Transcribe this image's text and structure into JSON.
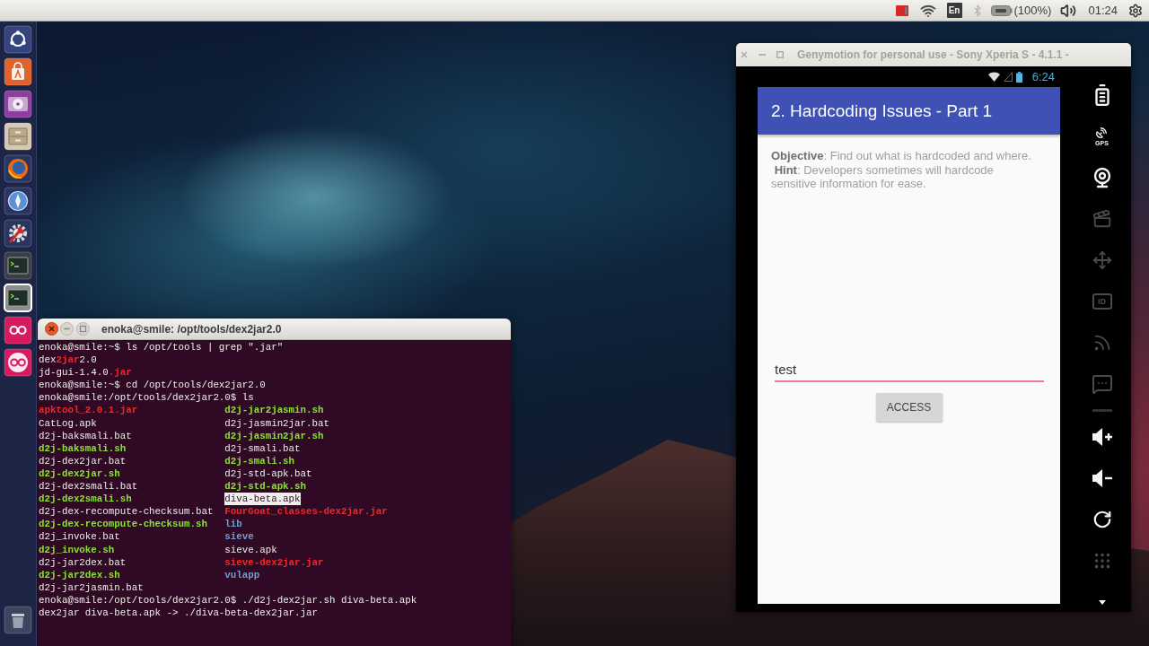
{
  "top_panel": {
    "keyboard_layout": "En",
    "battery": "(100%)",
    "clock": "01:24"
  },
  "launcher": {
    "items": [
      {
        "kind": "dash",
        "focused": false
      },
      {
        "kind": "software",
        "focused": false
      },
      {
        "kind": "media",
        "focused": false
      },
      {
        "kind": "files",
        "focused": false
      },
      {
        "kind": "browser",
        "focused": false
      },
      {
        "kind": "web",
        "focused": false
      },
      {
        "kind": "settings",
        "focused": false
      },
      {
        "kind": "terminal",
        "focused": false
      },
      {
        "kind": "terminal",
        "focused": true
      },
      {
        "kind": "rings",
        "focused": false
      },
      {
        "kind": "ringdisc",
        "focused": false
      }
    ]
  },
  "terminal": {
    "title": "enoka@smile: /opt/tools/dex2jar2.0",
    "head": [
      [
        {
          "text": "enoka@smile:~$ ls /opt/tools | grep \".jar\"",
          "kind": "plain"
        }
      ],
      [
        {
          "text": "dex",
          "kind": "plain"
        },
        {
          "text": "2jar",
          "kind": "match"
        },
        {
          "text": "2.0",
          "kind": "plain"
        }
      ],
      [
        {
          "text": "jd-gui-1.4.0",
          "kind": "plain"
        },
        {
          "text": ".jar",
          "kind": "match"
        }
      ],
      [
        {
          "text": "enoka@smile:~$ cd /opt/tools/dex2jar2.0",
          "kind": "plain"
        }
      ],
      [
        {
          "text": "enoka@smile:/opt/tools/dex2jar2.0$ ls",
          "kind": "plain"
        }
      ]
    ],
    "listing": [
      {
        "cells": [
          {
            "name": "apktool_2.0.1.jar",
            "kind": "archive",
            "selected": false
          },
          {
            "name": "d2j-jar2jasmin.sh",
            "kind": "script",
            "selected": false
          }
        ]
      },
      {
        "cells": [
          {
            "name": "CatLog.apk",
            "kind": "file",
            "selected": false
          },
          {
            "name": "d2j-jasmin2jar.bat",
            "kind": "file",
            "selected": false
          }
        ]
      },
      {
        "cells": [
          {
            "name": "d2j-baksmali.bat",
            "kind": "file",
            "selected": false
          },
          {
            "name": "d2j-jasmin2jar.sh",
            "kind": "script",
            "selected": false
          }
        ]
      },
      {
        "cells": [
          {
            "name": "d2j-baksmali.sh",
            "kind": "script",
            "selected": false
          },
          {
            "name": "d2j-smali.bat",
            "kind": "file",
            "selected": false
          }
        ]
      },
      {
        "cells": [
          {
            "name": "d2j-dex2jar.bat",
            "kind": "file",
            "selected": false
          },
          {
            "name": "d2j-smali.sh",
            "kind": "script",
            "selected": false
          }
        ]
      },
      {
        "cells": [
          {
            "name": "d2j-dex2jar.sh",
            "kind": "script",
            "selected": false
          },
          {
            "name": "d2j-std-apk.bat",
            "kind": "file",
            "selected": false
          }
        ]
      },
      {
        "cells": [
          {
            "name": "d2j-dex2smali.bat",
            "kind": "file",
            "selected": false
          },
          {
            "name": "d2j-std-apk.sh",
            "kind": "script",
            "selected": false
          }
        ]
      },
      {
        "cells": [
          {
            "name": "d2j-dex2smali.sh",
            "kind": "script",
            "selected": false
          },
          {
            "name": "diva-beta.apk",
            "kind": "file",
            "selected": true
          }
        ]
      },
      {
        "cells": [
          {
            "name": "d2j-dex-recompute-checksum.bat",
            "kind": "file",
            "selected": false
          },
          {
            "name": "FourGoat_classes-dex2jar.jar",
            "kind": "archive",
            "selected": false
          }
        ]
      },
      {
        "cells": [
          {
            "name": "d2j-dex-recompute-checksum.sh",
            "kind": "script",
            "selected": false
          },
          {
            "name": "lib",
            "kind": "folder",
            "selected": false
          }
        ]
      },
      {
        "cells": [
          {
            "name": "d2j_invoke.bat",
            "kind": "file",
            "selected": false
          },
          {
            "name": "sieve",
            "kind": "folder",
            "selected": false
          }
        ]
      },
      {
        "cells": [
          {
            "name": "d2j_invoke.sh",
            "kind": "script",
            "selected": false
          },
          {
            "name": "sieve.apk",
            "kind": "file",
            "selected": false
          }
        ]
      },
      {
        "cells": [
          {
            "name": "d2j-jar2dex.bat",
            "kind": "file",
            "selected": false
          },
          {
            "name": "sieve-dex2jar.jar",
            "kind": "archive",
            "selected": false
          }
        ]
      },
      {
        "cells": [
          {
            "name": "d2j-jar2dex.sh",
            "kind": "script",
            "selected": false
          },
          {
            "name": "vulapp",
            "kind": "folder",
            "selected": false
          }
        ]
      },
      {
        "cells": [
          {
            "name": "d2j-jar2jasmin.bat",
            "kind": "file",
            "selected": false
          }
        ]
      }
    ],
    "tail": [
      [
        {
          "text": "enoka@smile:/opt/tools/dex2jar2.0$ ./d2j-dex2jar.sh diva-beta.apk",
          "kind": "plain"
        }
      ],
      [
        {
          "text": "dex2jar diva-beta.apk -> ./diva-beta-dex2jar.jar",
          "kind": "plain"
        }
      ]
    ]
  },
  "genymotion": {
    "title": "Genymotion for personal use - Sony Xperia S - 4.1.1 -",
    "status_time": "6:24",
    "app_title": "2. Hardcoding Issues - Part 1",
    "description": "**Objective**: Find out what is hardcoded and where.\n **Hint**: Developers sometimes will hardcode sensitive information for ease.",
    "input_value": "test",
    "button": "ACCESS",
    "toolbar": [
      {
        "kind": "battery",
        "disabled": false
      },
      {
        "kind": "gps",
        "label": "GPS",
        "disabled": false
      },
      {
        "kind": "webcam",
        "disabled": false
      },
      {
        "kind": "video",
        "disabled": true
      },
      {
        "kind": "dpad",
        "disabled": true
      },
      {
        "kind": "id",
        "label": "ID",
        "disabled": true
      },
      {
        "kind": "rss",
        "disabled": true
      },
      {
        "kind": "sms",
        "disabled": true
      },
      {
        "kind": "volup",
        "disabled": false
      },
      {
        "kind": "voldown",
        "disabled": false
      },
      {
        "kind": "rotate",
        "disabled": false
      },
      {
        "kind": "keys",
        "disabled": true
      },
      {
        "kind": "down",
        "disabled": false
      }
    ]
  }
}
